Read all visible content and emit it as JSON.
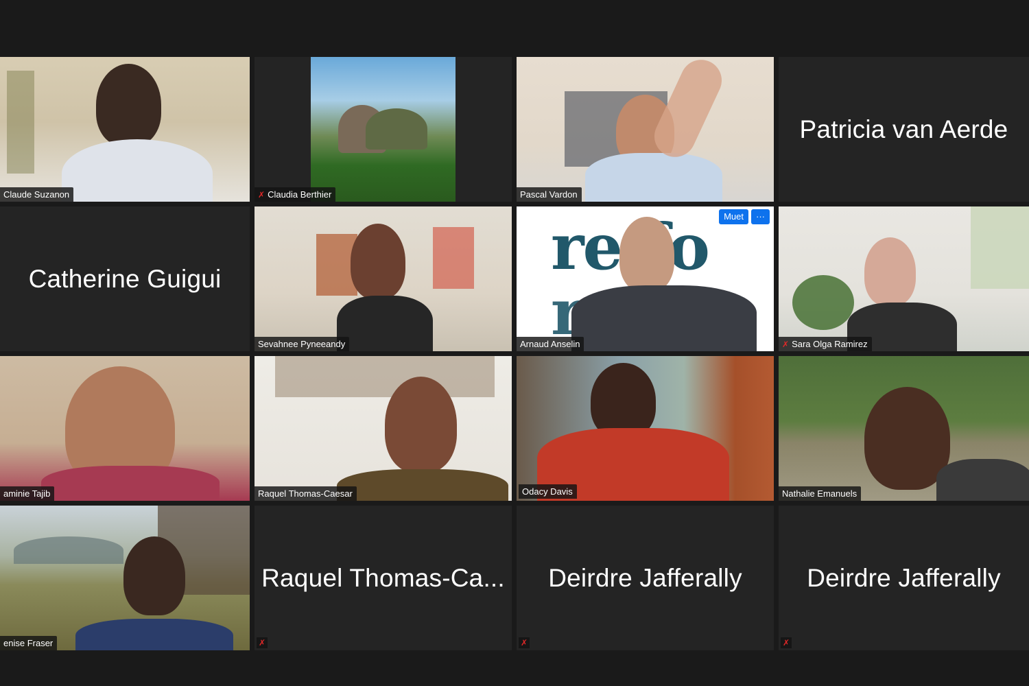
{
  "meeting": {
    "participants": [
      {
        "name": "Claude Suzanon",
        "type": "video",
        "muted": false
      },
      {
        "name": "Claudia Berthier",
        "type": "video",
        "muted": true
      },
      {
        "name": "Pascal Vardon",
        "type": "video",
        "muted": false
      },
      {
        "name": "Patricia van Aerde",
        "type": "name-only",
        "muted": false
      },
      {
        "name": "Catherine Guigui",
        "type": "name-only",
        "muted": false
      },
      {
        "name": "Sevahnee Pyneeandy",
        "type": "video",
        "muted": false
      },
      {
        "name": "Arnaud Anselin",
        "type": "video",
        "muted": false,
        "controls": {
          "mute_label": "Muet",
          "more_label": "···"
        },
        "logo_text_top": "re fo",
        "logo_text_bottom": "r a"
      },
      {
        "name": "Sara Olga Ramirez",
        "type": "video",
        "muted": true
      },
      {
        "name": "Kaminie Tajib",
        "display_label": "aminie Tajib",
        "type": "video",
        "muted": false
      },
      {
        "name": "Raquel Thomas-Caesar",
        "type": "video",
        "muted": false
      },
      {
        "name": "Odacy Davis",
        "type": "video",
        "muted": false,
        "active_speaker": true
      },
      {
        "name": "Nathalie Emanuels",
        "type": "video",
        "muted": false
      },
      {
        "name": "Denise Fraser",
        "display_label": "enise Fraser",
        "type": "video",
        "muted": false
      },
      {
        "name": "Raquel Thomas-Ca...",
        "type": "name-only",
        "muted": true
      },
      {
        "name": "Deirdre Jafferally",
        "type": "name-only",
        "muted": true
      },
      {
        "name": "Deirdre Jafferally",
        "type": "name-only",
        "muted": true
      }
    ]
  },
  "icons": {
    "muted": "muted-mic-icon",
    "mic_glyph": "✗"
  },
  "colors": {
    "background": "#1a1a1a",
    "tile": "#242424",
    "active_border": "#d6e078",
    "button": "#0e72ed",
    "muted": "#e02828"
  }
}
